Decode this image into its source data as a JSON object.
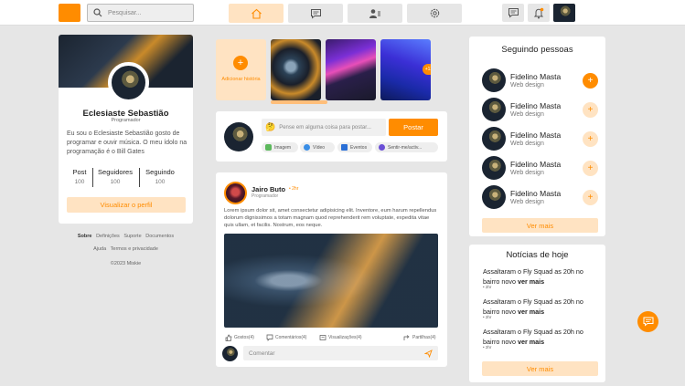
{
  "header": {
    "search_placeholder": "Pesquisar..."
  },
  "profile": {
    "name": "Eclesiaste Sebastião",
    "role": "Programador",
    "bio": "Eu sou o  Eclesiaste Sebastião gosto de programar e ouvir música. O meu ídolo na programação é o Bill Gates",
    "stats": [
      {
        "label": "Post",
        "value": "100"
      },
      {
        "label": "Seguidores",
        "value": "100"
      },
      {
        "label": "Seguindo",
        "value": "100"
      }
    ],
    "view_profile": "Visualizar o perfil"
  },
  "footer_links": {
    "line1": [
      "Sobre",
      "Definições",
      "Suporte",
      "Documentos"
    ],
    "line2": [
      "Ajuda",
      "Termos e privacidade"
    ],
    "copyright": "©2023 Miskie"
  },
  "stories": {
    "add_label": "Adicionar história",
    "more_badge": "+12"
  },
  "composer": {
    "placeholder": "Pense em alguma coisa para postar...",
    "post_button": "Postar",
    "chips": [
      "Imagem",
      "Vídeo",
      "Eventos",
      "Sentir-me/activ..."
    ]
  },
  "post": {
    "author": "Jairo Buto",
    "time": "2hr",
    "role": "Programador",
    "text": "Lorem ipsum dolor sit, amet consectetur adipisicing elit. Inventore, eum harum repellendus dolorum dignissimos a totam magnam quod reprehenderit rem voluptate, expedita vitae quis ullam, et facilis. Nostrum, eos neque.",
    "actions": [
      "Gostos(4)",
      "Comentários(4)",
      "Visualizações(4)",
      "Partilhas(4)"
    ],
    "comment_placeholder": "Comentar"
  },
  "following": {
    "title": "Seguindo pessoas",
    "people": [
      {
        "name": "Fidelino Masta",
        "role": "Web design"
      },
      {
        "name": "Fidelino Masta",
        "role": "Web design"
      },
      {
        "name": "Fidelino Masta",
        "role": "Web design"
      },
      {
        "name": "Fidelino Masta",
        "role": "Web design"
      },
      {
        "name": "Fidelino Masta",
        "role": "Web design"
      }
    ],
    "see_more": "Ver mais"
  },
  "news": {
    "title": "Notícias de hoje",
    "items": [
      {
        "text": "Assaltaram o Fly Squad as 20h no bairro novo ",
        "more": "ver mais",
        "time": "2hr"
      },
      {
        "text": "Assaltaram o Fly Squad as 20h no bairro novo ",
        "more": "ver mais",
        "time": "2hr"
      },
      {
        "text": "Assaltaram o Fly Squad as 20h no bairro novo ",
        "more": "ver mais",
        "time": "2hr"
      }
    ],
    "see_more": "Ver mais"
  },
  "colors": {
    "accent": "#ff8c00",
    "accent_light": "#ffe3c2",
    "background": "#e6e6e6"
  }
}
